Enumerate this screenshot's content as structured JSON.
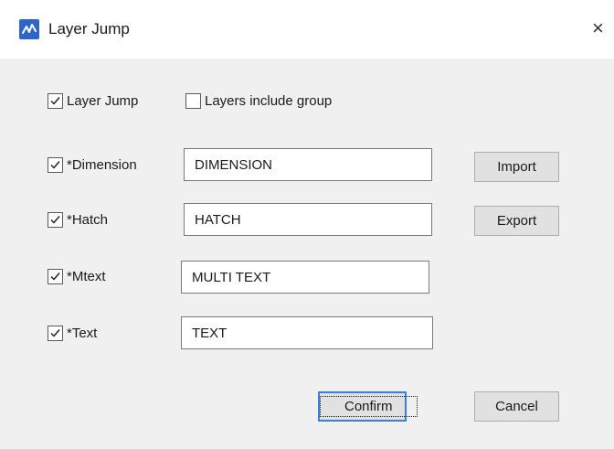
{
  "window": {
    "title": "Layer Jump",
    "close_glyph": "×",
    "app_icon": "app-logo-icon",
    "accent_color": "#3c7fd8"
  },
  "options": {
    "layer_jump": {
      "label": "Layer Jump",
      "checked": true
    },
    "layers_include_group": {
      "label": "Layers include group",
      "checked": false
    }
  },
  "layers": [
    {
      "label": "*Dimension",
      "checked": true,
      "value": "DIMENSION"
    },
    {
      "label": "*Hatch",
      "checked": true,
      "value": "HATCH"
    },
    {
      "label": "*Mtext",
      "checked": true,
      "value": "MULTI TEXT"
    },
    {
      "label": "*Text",
      "checked": true,
      "value": "TEXT"
    }
  ],
  "buttons": {
    "import": "Import",
    "export": "Export",
    "confirm": "Confirm",
    "cancel": "Cancel"
  }
}
